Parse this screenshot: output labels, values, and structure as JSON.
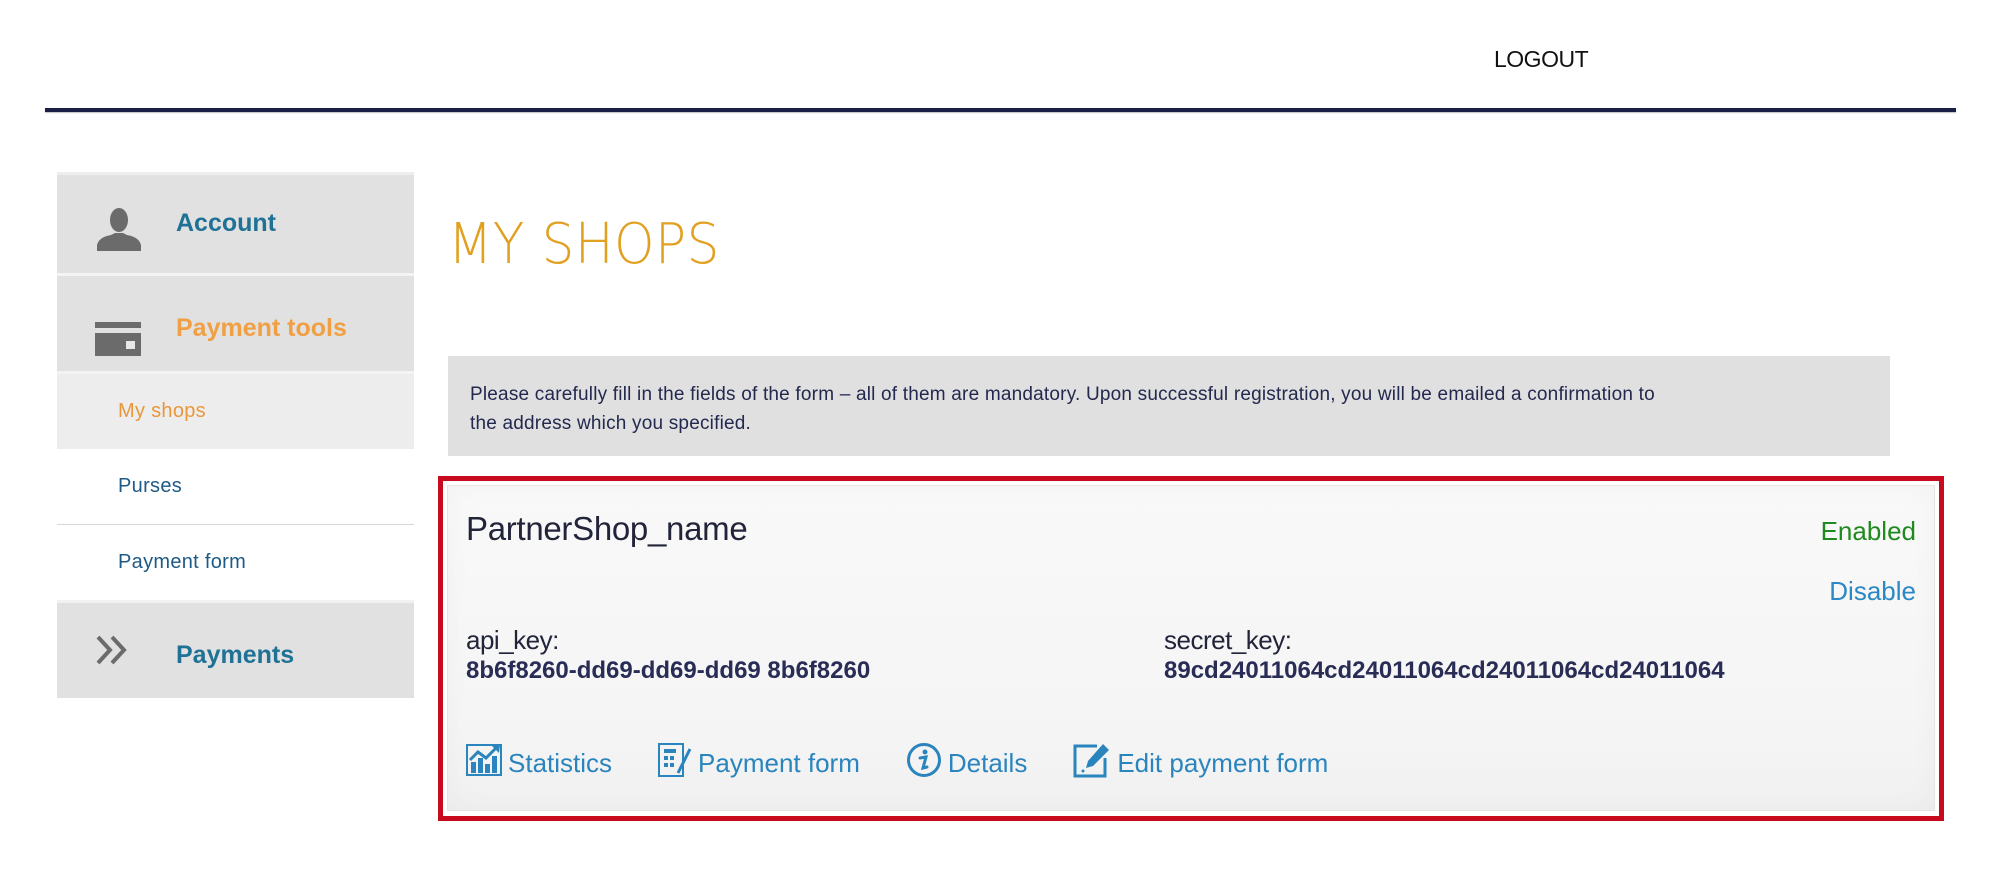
{
  "header": {
    "logout_label": "LOGOUT"
  },
  "sidebar": {
    "sections": [
      {
        "label": "Account",
        "icon": "user-icon"
      },
      {
        "label": "Payment tools",
        "icon": "credit-card-icon",
        "active": true,
        "items": [
          {
            "label": "My shops",
            "active": true
          },
          {
            "label": "Purses"
          },
          {
            "label": "Payment form"
          }
        ]
      },
      {
        "label": "Payments",
        "icon": "double-chevron-right-icon"
      }
    ]
  },
  "main": {
    "title": "MY SHOPS",
    "info_text": "Please carefully fill in the fields of the form – all of them are mandatory. Upon successful registration, you will be emailed a confirmation to the address which you specified.",
    "shop": {
      "name": "PartnerShop_name",
      "status": "Enabled",
      "toggle_label": "Disable",
      "api_key_label": "api_key:",
      "api_key_value": "8b6f8260-dd69-dd69-dd69 8b6f8260",
      "secret_key_label": "secret_key:",
      "secret_key_value": "89cd24011064cd24011064cd24011064cd24011064",
      "actions": [
        {
          "label": "Statistics",
          "icon": "chart-icon"
        },
        {
          "label": "Payment form",
          "icon": "form-icon"
        },
        {
          "label": "Details",
          "icon": "info-icon"
        },
        {
          "label": "Edit payment form",
          "icon": "edit-icon"
        }
      ]
    }
  },
  "colors": {
    "accent_orange": "#e1a020",
    "link_blue": "#2a84bd",
    "nav_blue": "#1f7295",
    "status_green": "#1f8a1f",
    "highlight_red": "#c80a1e",
    "header_rule": "#1b1e45"
  }
}
